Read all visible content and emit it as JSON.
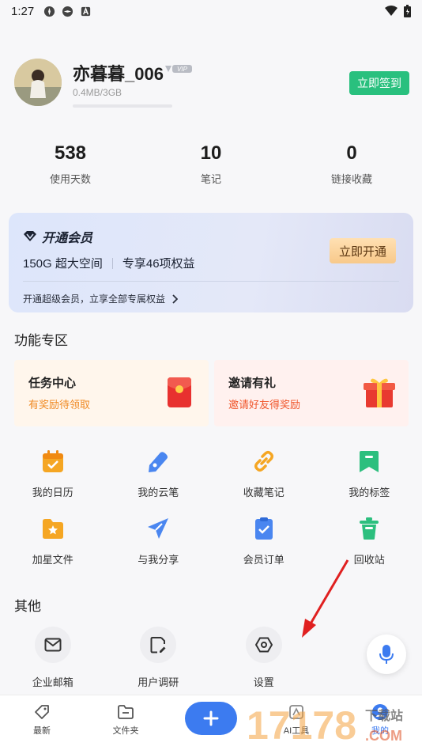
{
  "status_bar": {
    "time": "1:27"
  },
  "profile": {
    "username": "亦暮暮_006",
    "vip_badge": "VIP",
    "storage_text": "0.4MB/3GB",
    "storage_used_fraction": 0.0001,
    "signin_label": "立即签到"
  },
  "stats": [
    {
      "value": "538",
      "label": "使用天数"
    },
    {
      "value": "10",
      "label": "笔记"
    },
    {
      "value": "0",
      "label": "链接收藏"
    }
  ],
  "vip_card": {
    "title": "开通会员",
    "benefit_1": "150G 超大空间",
    "benefit_2": "专享46项权益",
    "open_label": "立即开通",
    "link_text": "开通超级会员，立享全部专属权益"
  },
  "features": {
    "title": "功能专区",
    "promo_tasks": {
      "title": "任务中心",
      "subtitle": "有奖励待领取"
    },
    "promo_invite": {
      "title": "邀请有礼",
      "subtitle": "邀请好友得奖励"
    },
    "row1": [
      {
        "label": "我的日历",
        "icon": "calendar-icon",
        "color": "#f5a623"
      },
      {
        "label": "我的云笔",
        "icon": "cloud-pen-icon",
        "color": "#4a86f0"
      },
      {
        "label": "收藏笔记",
        "icon": "link-icon",
        "color": "#f5a623"
      },
      {
        "label": "我的标签",
        "icon": "bookmark-icon",
        "color": "#2cbf7e"
      }
    ],
    "row2": [
      {
        "label": "加星文件",
        "icon": "star-folder-icon",
        "color": "#f5a623"
      },
      {
        "label": "与我分享",
        "icon": "send-icon",
        "color": "#4a86f0"
      },
      {
        "label": "会员订单",
        "icon": "order-icon",
        "color": "#4a86f0"
      },
      {
        "label": "回收站",
        "icon": "trash-icon",
        "color": "#2cbf7e"
      }
    ]
  },
  "other": {
    "title": "其他",
    "items": [
      {
        "label": "企业邮箱",
        "icon": "mail-icon"
      },
      {
        "label": "用户调研",
        "icon": "survey-icon"
      },
      {
        "label": "设置",
        "icon": "settings-icon"
      }
    ]
  },
  "bottom_nav": {
    "recent": "最新",
    "folder": "文件夹",
    "ai": "AI工具",
    "mine": "我的"
  },
  "watermark": {
    "text": "17178",
    "sub1": "下载站",
    "sub2": ".COM"
  },
  "colors": {
    "accent_green": "#29c07e",
    "accent_blue": "#3c7bf0",
    "annotation_red": "#e02020"
  }
}
